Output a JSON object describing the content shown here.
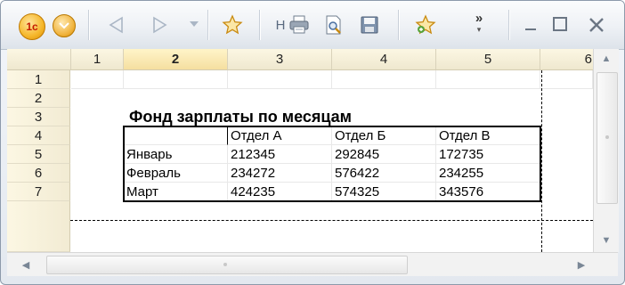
{
  "toolbar": {
    "logo_text": "1с",
    "hint_label": "H",
    "more_label": "»"
  },
  "sheet": {
    "col_headers": [
      "1",
      "2",
      "3",
      "4",
      "5",
      "6"
    ],
    "row_headers": [
      "1",
      "2",
      "3",
      "4",
      "5",
      "6",
      "7"
    ],
    "active_column": "2",
    "title": "Фонд зарплаты по месяцам",
    "table": {
      "headers": [
        "",
        "Отдел А",
        "Отдел Б",
        "Отдел В"
      ],
      "rows": [
        [
          "Январь",
          "212345",
          "292845",
          "172735"
        ],
        [
          "Февраль",
          "234272",
          "576422",
          "234255"
        ],
        [
          "Март",
          "424235",
          "574325",
          "343576"
        ]
      ]
    }
  },
  "colors": {
    "header_bg": "#f7f1da",
    "active_header_bg": "#f8e7ad",
    "border": "#000000",
    "accent": "#f5b72b"
  }
}
